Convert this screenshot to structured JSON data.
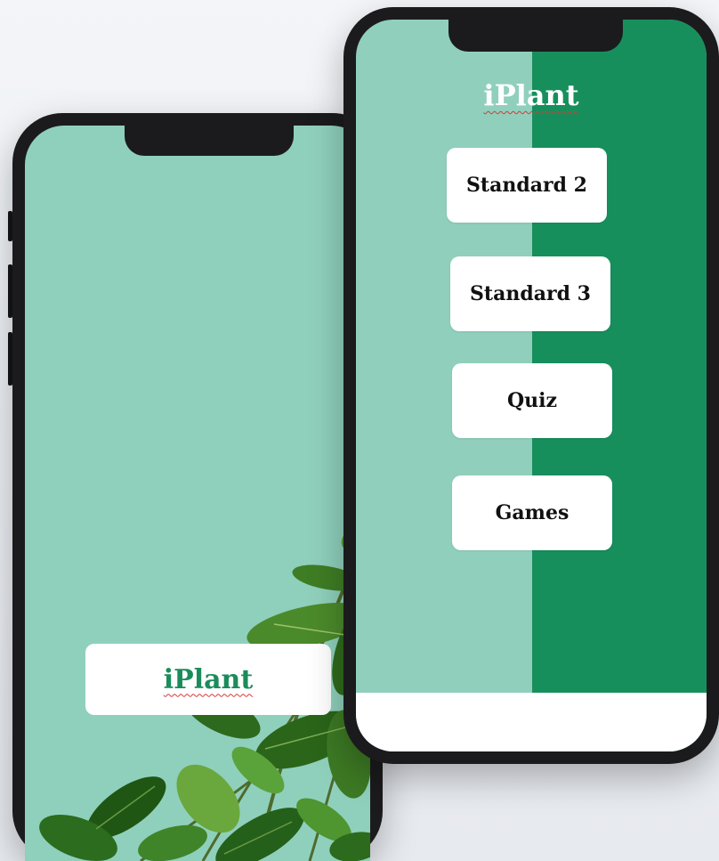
{
  "splash": {
    "app_name": "iPlant"
  },
  "menu": {
    "title": "iPlant",
    "items": [
      {
        "label": "Standard 2"
      },
      {
        "label": "Standard 3"
      },
      {
        "label": "Quiz"
      },
      {
        "label": "Games"
      }
    ]
  },
  "colors": {
    "light_green": "#90cfbc",
    "dark_green": "#178f5c",
    "brand_text": "#1a8c5b",
    "button_bg": "#ffffff"
  },
  "icons": [
    "plant-leaves-image"
  ]
}
